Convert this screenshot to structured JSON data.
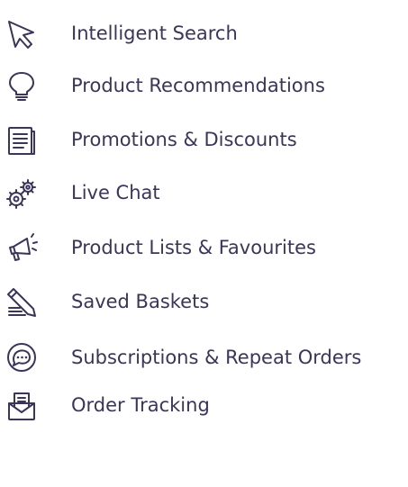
{
  "features": [
    {
      "label": "Intelligent Search",
      "icon": "cursor-arrow-icon"
    },
    {
      "label": "Product Recommendations",
      "icon": "lightbulb-icon"
    },
    {
      "label": "Promotions & Discounts",
      "icon": "document-icon"
    },
    {
      "label": "Live Chat",
      "icon": "gears-icon"
    },
    {
      "label": "Product Lists & Favourites",
      "icon": "megaphone-icon"
    },
    {
      "label": "Saved Baskets",
      "icon": "pencil-writing-icon"
    },
    {
      "label": "Subscriptions & Repeat Orders",
      "icon": "speech-bubble-icon"
    },
    {
      "label": "Order Tracking",
      "icon": "envelope-letter-icon"
    }
  ],
  "colors": {
    "text": "#3a3559",
    "icon": "#3a3559",
    "background": "#ffffff"
  }
}
